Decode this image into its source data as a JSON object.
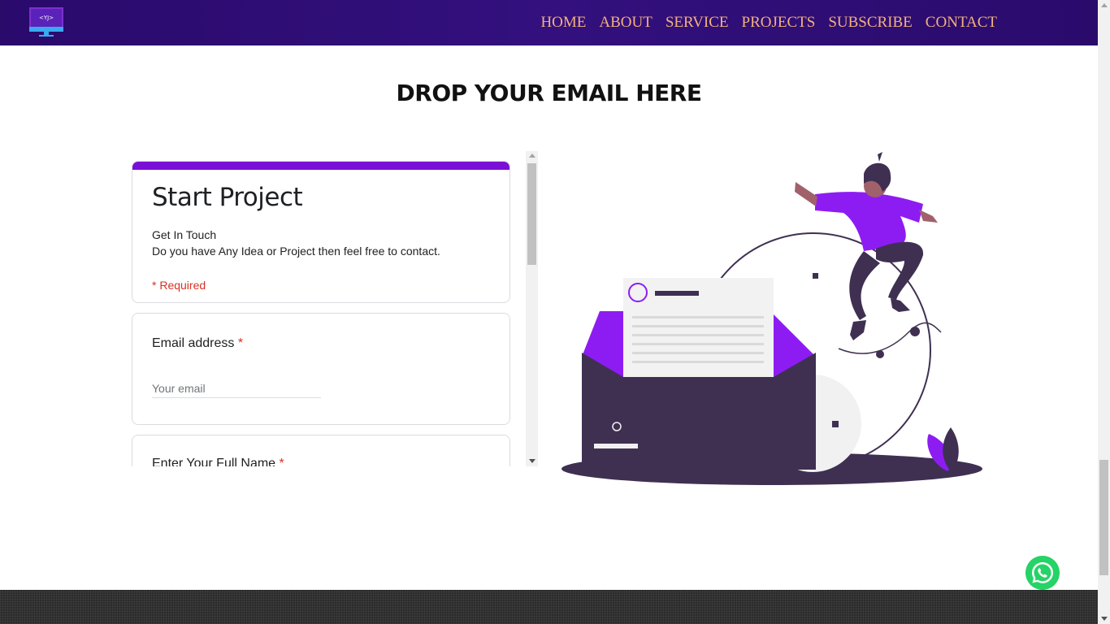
{
  "header": {
    "logo_icon": "monitor-logo-icon",
    "logo_text": "<YJ>",
    "nav": [
      "HOME",
      "ABOUT",
      "SERVICE",
      "PROJECTS",
      "SUBSCRIBE",
      "CONTACT"
    ]
  },
  "section": {
    "title": "DROP YOUR EMAIL HERE"
  },
  "form": {
    "title": "Start Project",
    "description_line1": "Get In Touch",
    "description_line2": "Do you have Any Idea or Project then feel free to contact.",
    "required_note": "* Required",
    "email": {
      "label": "Email address",
      "required_mark": "*",
      "placeholder": "Your email"
    },
    "name": {
      "label": "Enter Your Full Name",
      "required_mark": "*"
    }
  },
  "illustration": "email-newsletter-illustration",
  "floating": {
    "icon": "whatsapp-icon"
  },
  "colors": {
    "navbar": "#2e0d75",
    "nav_link": "#f3b27a",
    "accent_purple": "#8d1cf2",
    "dark_purple": "#3f3052",
    "required_red": "#d93025",
    "whatsapp_green": "#25d366",
    "footer": "#2b2b2b"
  }
}
